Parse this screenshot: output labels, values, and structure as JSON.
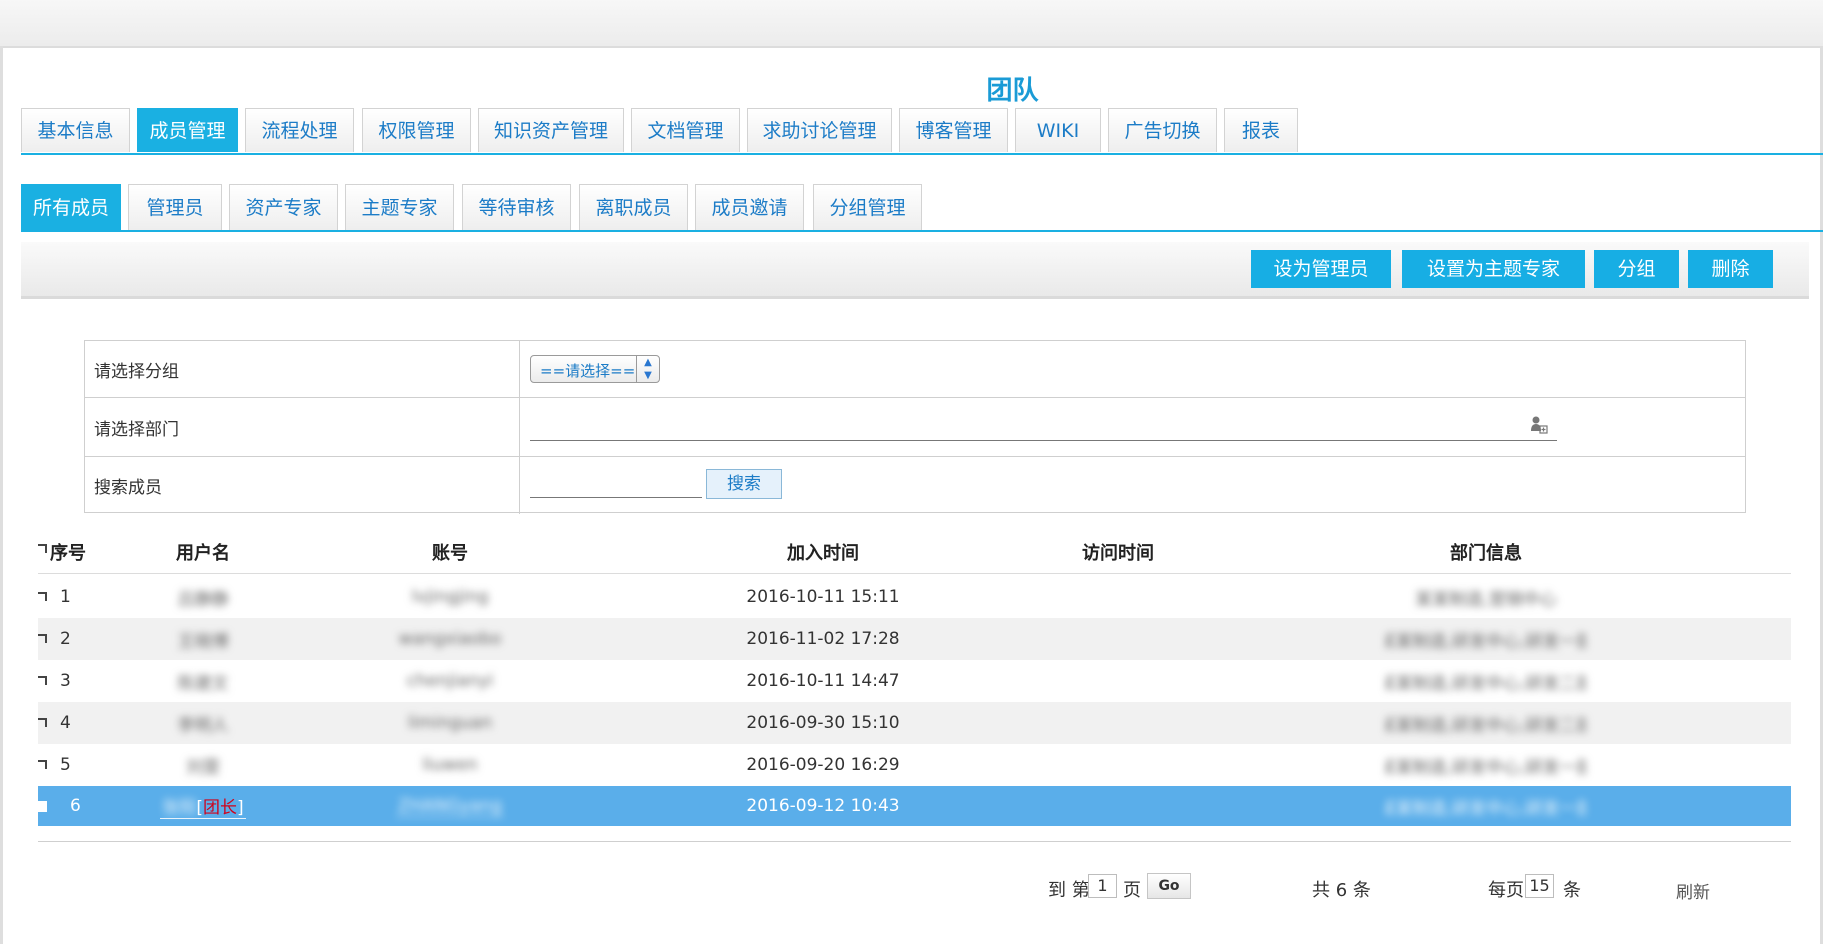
{
  "page": {
    "title": "团队"
  },
  "main_tabs": [
    {
      "label": "基本信息",
      "active": false
    },
    {
      "label": "成员管理",
      "active": true
    },
    {
      "label": "流程处理",
      "active": false
    },
    {
      "label": "权限管理",
      "active": false
    },
    {
      "label": "知识资产管理",
      "active": false
    },
    {
      "label": "文档管理",
      "active": false
    },
    {
      "label": "求助讨论管理",
      "active": false
    },
    {
      "label": "博客管理",
      "active": false
    },
    {
      "label": "WIKI",
      "active": false
    },
    {
      "label": "广告切换",
      "active": false
    },
    {
      "label": "报表",
      "active": false
    }
  ],
  "sub_tabs": [
    {
      "label": "所有成员",
      "active": true
    },
    {
      "label": "管理员",
      "active": false
    },
    {
      "label": "资产专家",
      "active": false
    },
    {
      "label": "主题专家",
      "active": false
    },
    {
      "label": "等待审核",
      "active": false
    },
    {
      "label": "离职成员",
      "active": false
    },
    {
      "label": "成员邀请",
      "active": false
    },
    {
      "label": "分组管理",
      "active": false
    }
  ],
  "toolbar": {
    "set_admin": "设为管理员",
    "set_topic_expert": "设置为主题专家",
    "group": "分组",
    "delete": "删除"
  },
  "filter": {
    "group_label": "请选择分组",
    "group_select_value": "==请选择==",
    "dept_label": "请选择部门",
    "search_label": "搜索成员",
    "search_button": "搜索"
  },
  "table": {
    "headers": {
      "index": "序号",
      "username": "用户名",
      "account": "账号",
      "join_time": "加入时间",
      "visit_time": "访问时间",
      "department": "部门信息"
    },
    "rows": [
      {
        "index": "1",
        "username": "吕静静",
        "account": "lvjingjing",
        "join_time": "2016-10-11 15:11",
        "visit_time": "",
        "department": "某某制造,营销中心",
        "leader": false
      },
      {
        "index": "2",
        "username": "王晓博",
        "account": "wangxiaobo",
        "join_time": "2016-11-02 17:28",
        "visit_time": "",
        "department": "某某制造,研发中心,研发一部",
        "leader": false
      },
      {
        "index": "3",
        "username": "陈建文",
        "account": "chenjianyi",
        "join_time": "2016-10-11 14:47",
        "visit_time": "",
        "department": "某某制造,研发中心,研发二部",
        "leader": false
      },
      {
        "index": "4",
        "username": "李明人",
        "account": "liminguan",
        "join_time": "2016-09-30 15:10",
        "visit_time": "",
        "department": "某某制造,研发中心,研发二部",
        "leader": false
      },
      {
        "index": "5",
        "username": "刘雯",
        "account": "liuwen",
        "join_time": "2016-09-20 16:29",
        "visit_time": "",
        "department": "某某制造,研发中心,研发一部",
        "leader": false
      },
      {
        "index": "6",
        "username": "张阳",
        "leader_tag": "团长",
        "account": "ZHANGyang",
        "join_time": "2016-09-12 10:43",
        "visit_time": "",
        "department": "某某制造,研发中心,研发一部",
        "leader": true
      }
    ]
  },
  "pager": {
    "goto_prefix": "到 第",
    "page_value": "1",
    "page_suffix": "页",
    "go": "Go",
    "total": "共 6 条",
    "per_page_prefix": "每页",
    "per_page_value": "15",
    "per_page_suffix": "条",
    "refresh": "刷新"
  },
  "colors": {
    "accent": "#1ab0e2",
    "selected_row": "#5aaeea",
    "alt_row": "#f1f1f1",
    "leader_tag": "#d0021b"
  }
}
